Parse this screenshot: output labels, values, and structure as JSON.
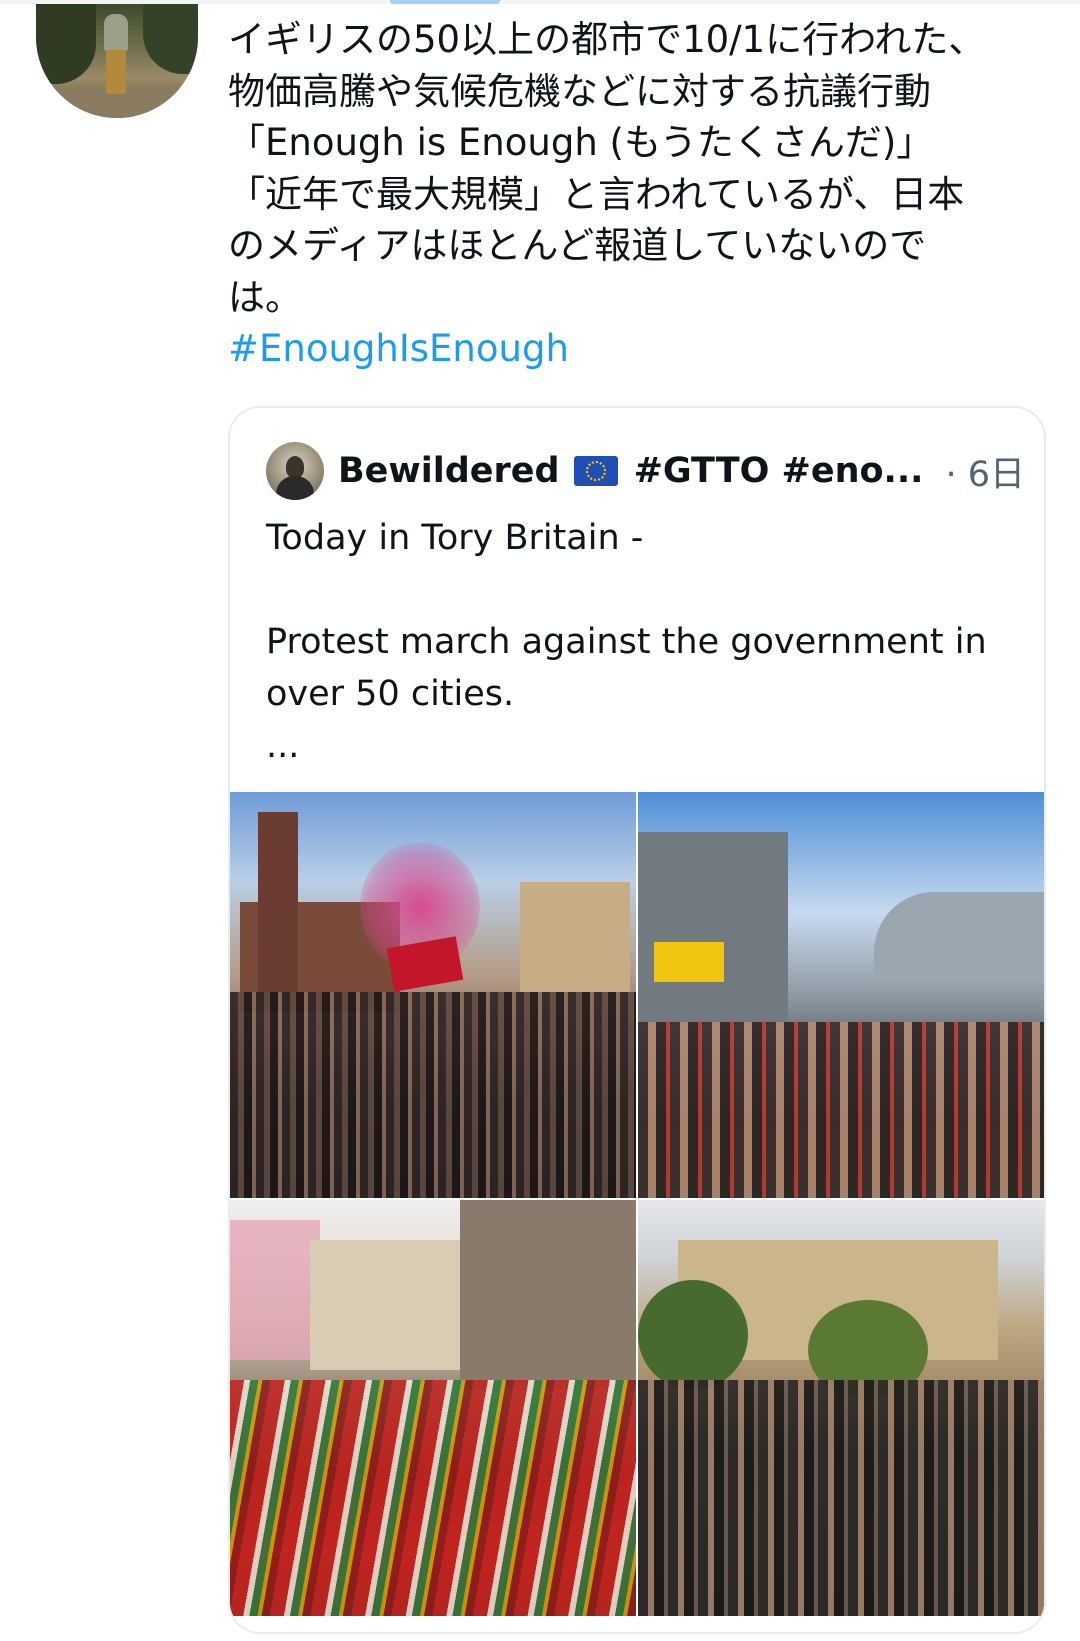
{
  "tweet": {
    "text_lines": [
      "イギリスの50以上の都市で10/1に行われた、",
      "物価高騰や気候危機などに対する抗議行動",
      "「Enough is Enough (もうたくさんだ)」",
      "「近年で最大規模」と言われているが、日本",
      "のメディアはほとんど報道していないので",
      "は。"
    ],
    "hashtag": "#EnoughIsEnough"
  },
  "quote": {
    "display_name": "Bewildered",
    "handle_truncated": "#GTTO #eno...",
    "time": "· 6日",
    "text_lines": [
      "Today in Tory Britain -",
      "",
      "Protest march against the  government in",
      "over 50 cities.",
      "..."
    ],
    "photos": [
      {
        "description_icon": "protest-photo"
      },
      {
        "description_icon": "protest-photo"
      },
      {
        "description_icon": "protest-photo"
      },
      {
        "description_icon": "protest-photo"
      }
    ]
  },
  "colors": {
    "link": "#1d9bf0",
    "text": "#0f1419",
    "muted": "#536471",
    "border": "#e6ecf0"
  }
}
